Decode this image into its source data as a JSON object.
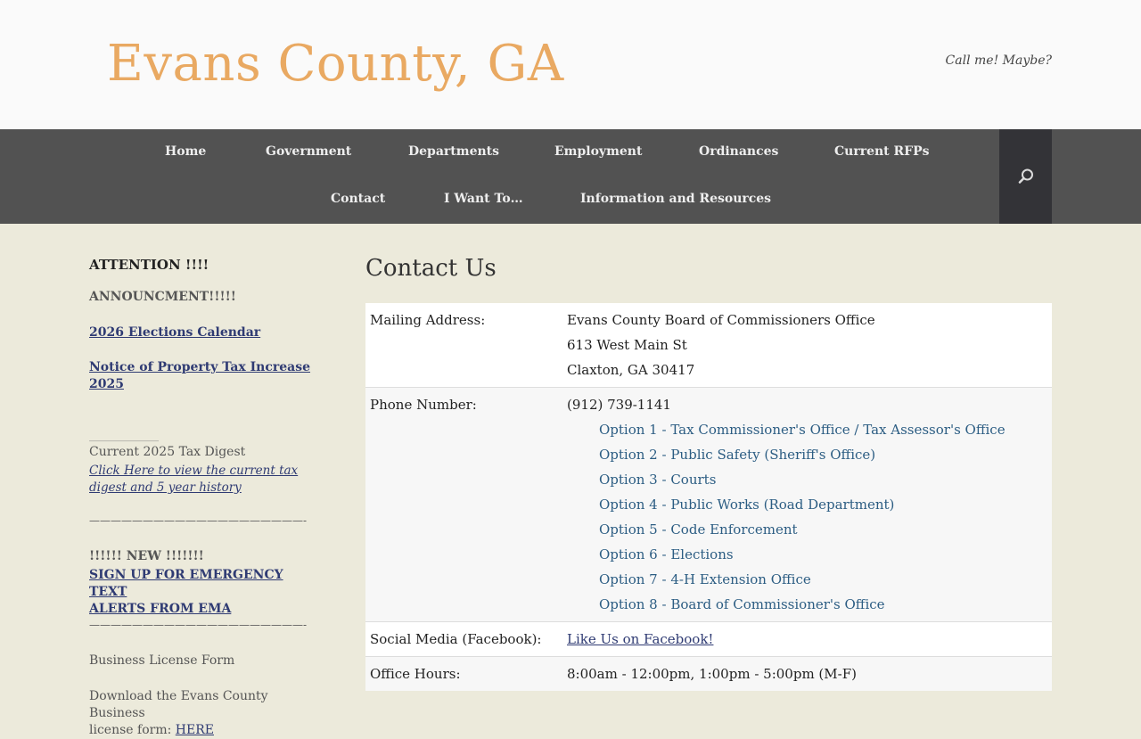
{
  "header": {
    "site_title": "Evans County, GA",
    "tagline": "Call me! Maybe?"
  },
  "nav": {
    "items": [
      "Home",
      "Government",
      "Departments",
      "Employment",
      "Ordinances",
      "Current RFPs",
      "Contact",
      "I Want To…",
      "Information and Resources"
    ],
    "search_icon": "search-icon"
  },
  "sidebar": {
    "attention": "ATTENTION !!!!",
    "announcement": "ANNOUNCMENT!!!!!",
    "elections_link": "2026 Elections Calendar",
    "tax_increase_link_1": "Notice of Property Tax Increase",
    "tax_increase_link_2": "2025",
    "rule_short": "____________",
    "tax_digest_label": "Current 2025 Tax Digest",
    "tax_digest_link_1": "Click Here to view the current tax",
    "tax_digest_link_2": "digest and 5 year history",
    "rule_long": "————————————————————-",
    "new_label": "!!!!!! NEW !!!!!!!",
    "ema_link_1": "SIGN UP FOR EMERGENCY TEXT",
    "ema_link_2": "ALERTS FROM EMA",
    "rule_long_2": "————————————————————-",
    "business_label": "Business License Form",
    "business_text": "Download the Evans County Business",
    "business_text_2": "license form:",
    "business_link": "HERE"
  },
  "content": {
    "title": "Contact Us",
    "mailing_label": "Mailing Address:",
    "mailing_lines": [
      "Evans County Board of Commissioners Office",
      "613 West Main St",
      "Claxton, GA 30417"
    ],
    "phone_label": "Phone Number:",
    "phone_number": "(912) 739-1141",
    "phone_options": [
      "Option 1 - Tax Commissioner's Office / Tax Assessor's Office",
      "Option 2 - Public Safety (Sheriff's Office)",
      "Option 3 - Courts",
      "Option 4 - Public Works (Road Department)",
      "Option 5 - Code Enforcement",
      "Option 6 - Elections",
      "Option 7 - 4-H Extension Office",
      "Option 8 - Board of Commissioner's Office"
    ],
    "social_label": "Social Media (Facebook):",
    "social_link": "Like Us on Facebook!",
    "hours_label": "Office Hours:",
    "hours_value": "8:00am - 12:00pm, 1:00pm - 5:00pm (M-F)"
  }
}
